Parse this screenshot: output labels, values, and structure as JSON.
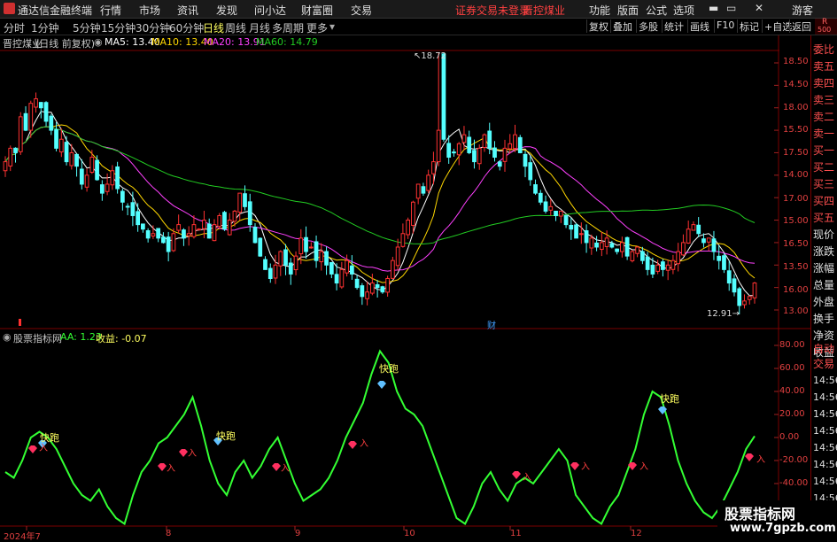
{
  "topbar": {
    "title": "通达信金融终端",
    "menu": [
      "行情",
      "市场",
      "资讯",
      "发现",
      "问小达",
      "财富圈",
      "交易"
    ],
    "notice": "证券交易未登录",
    "stock_tag": "晋控煤业",
    "right_menu": [
      "功能",
      "版面",
      "公式",
      "选项"
    ],
    "user": "游客"
  },
  "tabs": [
    "分时",
    "1分钟",
    "5分钟",
    "15分钟",
    "30分钟",
    "60分钟",
    "日线",
    "周线",
    "月线",
    "多周期",
    "更多"
  ],
  "active_tab": "日线",
  "right_buttons": [
    "复权",
    "叠加",
    "多股",
    "统计",
    "画线",
    "F10",
    "标记",
    "+自选",
    "返回"
  ],
  "info": {
    "stock": "晋控煤业",
    "period": "(日线 前复权)",
    "ma5": "MA5: 13.40",
    "ma10": "MA10: 13.40",
    "ma20": "MA20: 13.91",
    "ma60": "MA60: 14.79"
  },
  "sub": {
    "name": "股票指标网",
    "aa": "AA: 1.23",
    "shouyi": "收益: -0.07"
  },
  "right_panel": {
    "r": "R",
    "r_num": "500",
    "items": [
      "委比",
      "卖五",
      "卖四",
      "卖三",
      "卖二",
      "卖一",
      "买一",
      "买二",
      "买三",
      "买四",
      "买五",
      "现价",
      "涨跌",
      "涨幅",
      "总量",
      "外盘",
      "换手",
      "净资",
      "收益"
    ],
    "sub_items": [
      "自动",
      "交易"
    ],
    "times": [
      "14:56",
      "14:56",
      "14:56",
      "14:56",
      "14:56",
      "14:56",
      "14:56",
      "14:56",
      "14:56"
    ]
  },
  "main_axis": [
    "18.50",
    "18.00",
    "17.50",
    "17.00",
    "16.50",
    "16.00",
    "15.50",
    "15.00",
    "14.50",
    "14.00",
    "13.50",
    "13.00"
  ],
  "sub_axis": [
    "80.00",
    "60.00",
    "40.00",
    "20.00",
    "0.00",
    "-20.00",
    "-40.00"
  ],
  "x_labels": [
    "2024年7",
    "8",
    "9",
    "10",
    "11",
    "12"
  ],
  "annotations": {
    "high": "18.72",
    "low": "12.91",
    "cai": "财"
  },
  "signals": {
    "run": "快跑",
    "buy": "入"
  },
  "watermark": {
    "cn": "股票指标网",
    "url": "www.7gpzb.com"
  },
  "colors": {
    "up": "#ff3232",
    "down": "#54ffff",
    "ma5": "#ffffff",
    "ma10": "#ffd700",
    "ma20": "#ff40ff",
    "ma60": "#22cc22",
    "indicator": "#33ff33"
  },
  "chart_data": {
    "type": "candlestick",
    "price_axis": {
      "min": 13.0,
      "max": 18.5
    },
    "close": [
      16.3,
      16.6,
      16.5,
      17.3,
      17.0,
      17.6,
      17.7,
      17.5,
      17.2,
      17.0,
      16.6,
      16.8,
      16.3,
      16.5,
      16.2,
      15.8,
      16.0,
      16.4,
      15.9,
      15.6,
      15.8,
      16.1,
      15.7,
      15.4,
      15.3,
      15.1,
      14.9,
      14.8,
      14.6,
      14.7,
      14.6,
      14.5,
      14.3,
      14.7,
      14.9,
      14.6,
      14.7,
      14.9,
      14.8,
      15.0,
      14.6,
      14.9,
      15.1,
      14.8,
      15.0,
      15.2,
      15.6,
      15.3,
      14.9,
      14.5,
      14.2,
      13.9,
      13.7,
      14.0,
      14.3,
      14.0,
      13.8,
      14.2,
      14.6,
      14.3,
      14.4,
      14.1,
      14.3,
      14.0,
      13.8,
      13.6,
      13.9,
      14.1,
      13.8,
      13.5,
      13.3,
      13.4,
      13.6,
      13.5,
      13.4,
      13.7,
      14.1,
      14.4,
      14.7,
      15.0,
      15.4,
      15.8,
      15.6,
      16.0,
      16.3,
      18.72,
      16.8,
      16.4,
      16.5,
      16.7,
      16.9,
      16.5,
      16.3,
      16.6,
      16.9,
      16.6,
      16.4,
      16.2,
      16.6,
      16.7,
      16.9,
      16.5,
      16.2,
      15.9,
      15.6,
      15.4,
      15.2,
      15.3,
      15.1,
      15.2,
      14.9,
      14.8,
      14.6,
      14.7,
      14.5,
      14.6,
      14.4,
      14.5,
      14.6,
      14.4,
      14.3,
      14.5,
      14.2,
      14.3,
      14.4,
      14.1,
      13.9,
      13.8,
      14.0,
      13.9,
      14.0,
      14.1,
      14.3,
      14.5,
      14.8,
      14.9,
      14.7,
      14.5,
      14.6,
      14.3,
      14.1,
      13.9,
      13.6,
      13.4,
      13.1,
      13.2,
      13.3,
      13.6
    ]
  }
}
